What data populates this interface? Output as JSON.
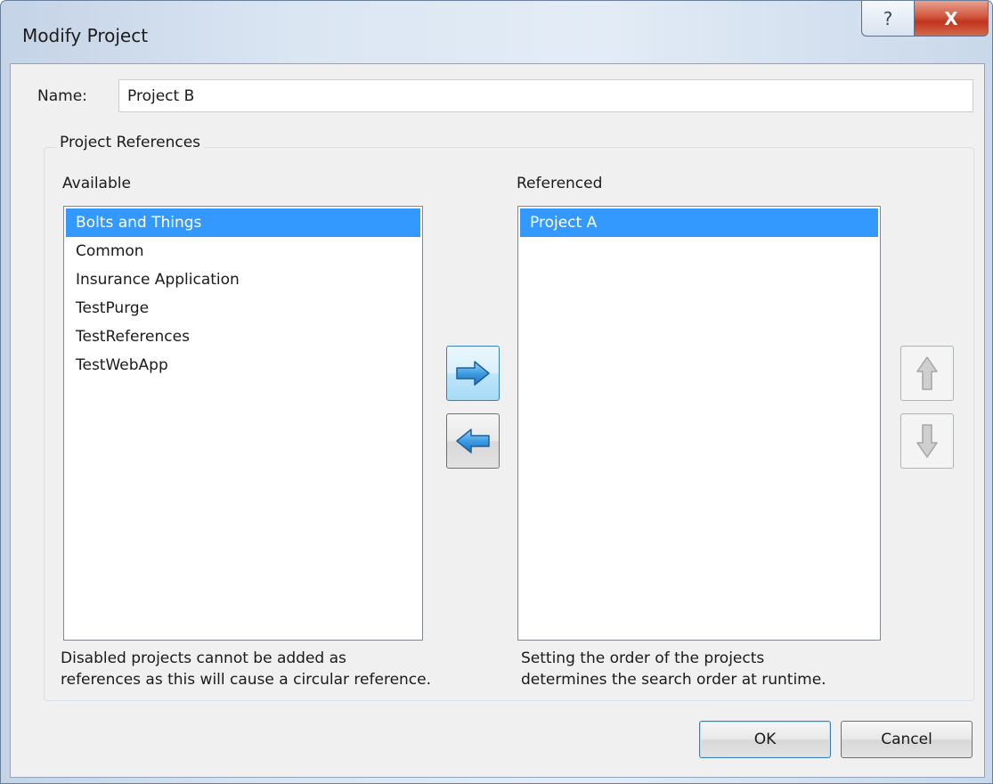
{
  "window": {
    "title": "Modify Project"
  },
  "titlebar": {
    "help_glyph": "?",
    "close_glyph": "X"
  },
  "name_field": {
    "label": "Name:",
    "value": "Project B"
  },
  "references": {
    "group_label": "Project References",
    "available": {
      "label": "Available",
      "items": [
        "Bolts and Things",
        "Common",
        "Insurance Application",
        "TestPurge",
        "TestReferences",
        "TestWebApp"
      ],
      "selected": "Bolts and Things",
      "hint_line1": "Disabled projects cannot be added as",
      "hint_line2": "references as this will cause a circular reference."
    },
    "referenced": {
      "label": "Referenced",
      "items": [
        "Project A"
      ],
      "selected": "Project A",
      "hint_line1": "Setting the order of the projects",
      "hint_line2": "determines the search order at runtime."
    }
  },
  "buttons": {
    "ok": "OK",
    "cancel": "Cancel"
  },
  "icons": {
    "add": "arrow-right-icon",
    "remove": "arrow-left-icon",
    "move_up": "arrow-up-icon",
    "move_down": "arrow-down-icon"
  },
  "colors": {
    "selection": "#3399ff",
    "arrow_blue": "#3b9be0",
    "arrow_disabled": "#bdbdbd"
  }
}
